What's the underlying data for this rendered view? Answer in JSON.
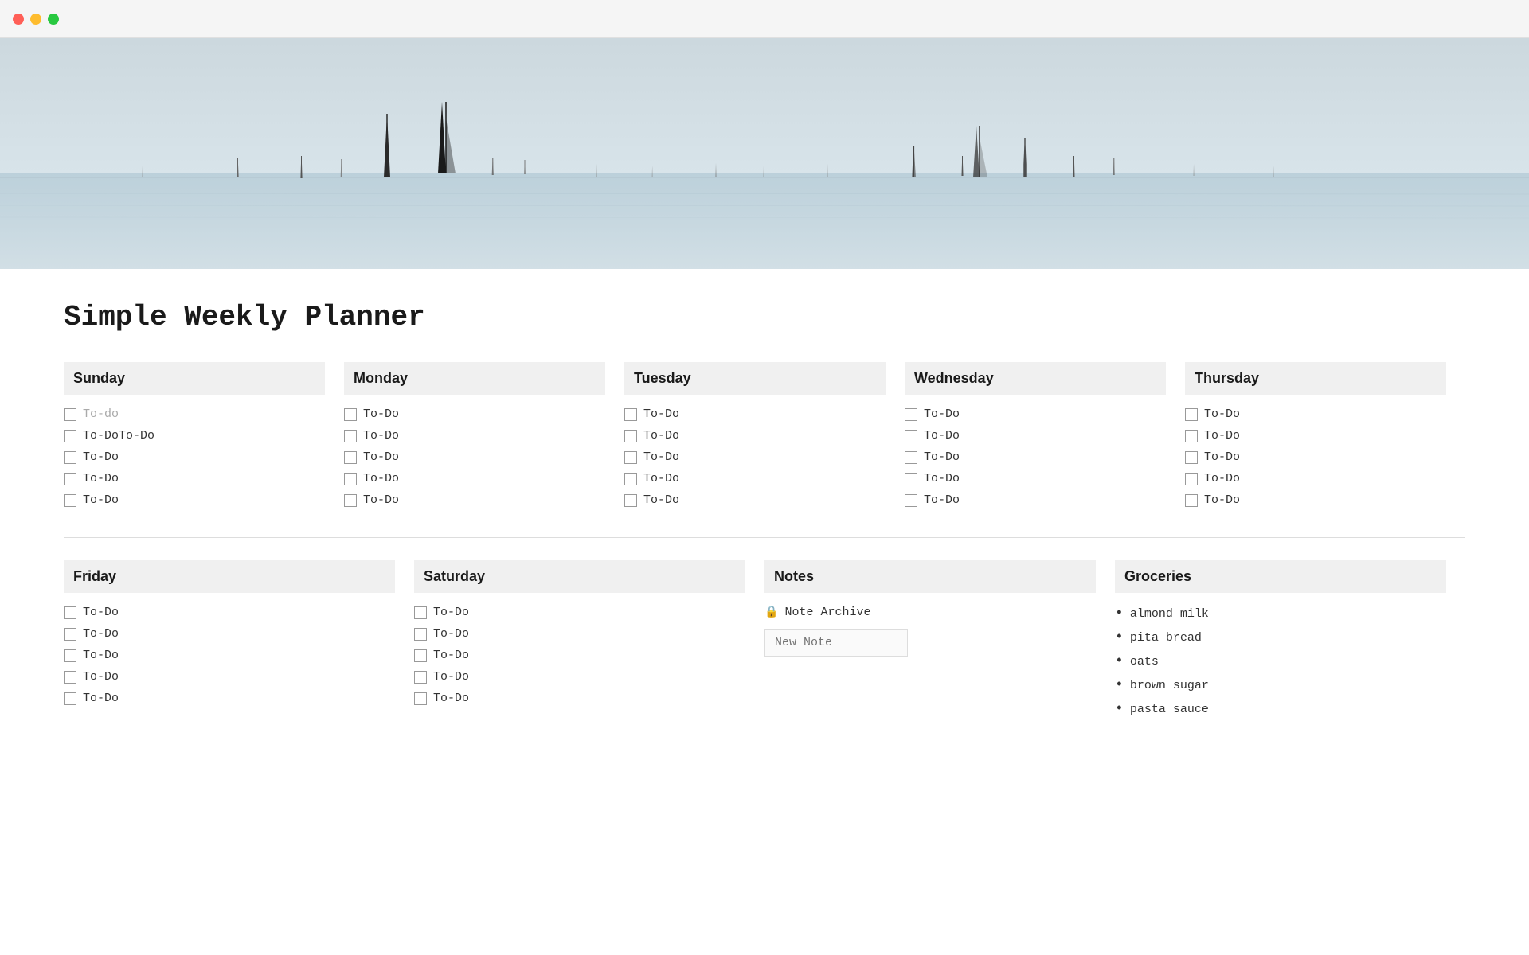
{
  "titlebar": {
    "close": "close",
    "minimize": "minimize",
    "maximize": "maximize"
  },
  "page": {
    "title": "Simple Weekly Planner"
  },
  "days_row1": [
    {
      "name": "Sunday",
      "todos": [
        {
          "text": "To-do",
          "placeholder": true
        },
        {
          "text": "To-DoTo-Do",
          "placeholder": false
        },
        {
          "text": "To-Do",
          "placeholder": false
        },
        {
          "text": "To-Do",
          "placeholder": false
        },
        {
          "text": "To-Do",
          "placeholder": false
        }
      ]
    },
    {
      "name": "Monday",
      "todos": [
        {
          "text": "To-Do",
          "placeholder": false
        },
        {
          "text": "To-Do",
          "placeholder": false
        },
        {
          "text": "To-Do",
          "placeholder": false
        },
        {
          "text": "To-Do",
          "placeholder": false
        },
        {
          "text": "To-Do",
          "placeholder": false
        }
      ]
    },
    {
      "name": "Tuesday",
      "todos": [
        {
          "text": "To-Do",
          "placeholder": false
        },
        {
          "text": "To-Do",
          "placeholder": false
        },
        {
          "text": "To-Do",
          "placeholder": false
        },
        {
          "text": "To-Do",
          "placeholder": false
        },
        {
          "text": "To-Do",
          "placeholder": false
        }
      ]
    },
    {
      "name": "Wednesday",
      "todos": [
        {
          "text": "To-Do",
          "placeholder": false
        },
        {
          "text": "To-Do",
          "placeholder": false
        },
        {
          "text": "To-Do",
          "placeholder": false
        },
        {
          "text": "To-Do",
          "placeholder": false
        },
        {
          "text": "To-Do",
          "placeholder": false
        }
      ]
    },
    {
      "name": "Thursday",
      "todos": [
        {
          "text": "To-Do",
          "placeholder": false
        },
        {
          "text": "To-Do",
          "placeholder": false
        },
        {
          "text": "To-Do",
          "placeholder": false
        },
        {
          "text": "To-Do",
          "placeholder": false
        },
        {
          "text": "To-Do",
          "placeholder": false
        }
      ]
    }
  ],
  "days_row2": [
    {
      "name": "Friday",
      "todos": [
        {
          "text": "To-Do"
        },
        {
          "text": "To-Do"
        },
        {
          "text": "To-Do"
        },
        {
          "text": "To-Do"
        },
        {
          "text": "To-Do"
        }
      ]
    },
    {
      "name": "Saturday",
      "todos": [
        {
          "text": "To-Do"
        },
        {
          "text": "To-Do"
        },
        {
          "text": "To-Do"
        },
        {
          "text": "To-Do"
        },
        {
          "text": "To-Do"
        }
      ]
    }
  ],
  "notes": {
    "header": "Notes",
    "archive_label": "Note Archive",
    "new_note_placeholder": "New Note"
  },
  "groceries": {
    "header": "Groceries",
    "items": [
      "almond milk",
      "pita bread",
      "oats",
      "brown sugar",
      "pasta sauce"
    ]
  }
}
